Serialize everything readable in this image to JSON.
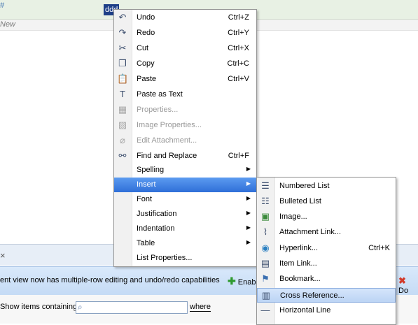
{
  "background": {
    "top_row_marker": "#",
    "selected_text": "ddd",
    "new_row_text": "New",
    "close_glyph": "×",
    "info_message": "ent view now has multiple-row editing and undo/redo capabilities",
    "enable_label": "Enab",
    "delete_label": "Do",
    "filter_label": "Show items containing",
    "filter_value": "",
    "where_label": "where"
  },
  "context_menu": {
    "items": [
      {
        "label": "Undo",
        "shortcut": "Ctrl+Z",
        "icon": "undo-icon",
        "disabled": false
      },
      {
        "label": "Redo",
        "shortcut": "Ctrl+Y",
        "icon": "redo-icon",
        "disabled": false
      },
      {
        "label": "Cut",
        "shortcut": "Ctrl+X",
        "icon": "cut-icon",
        "disabled": false
      },
      {
        "label": "Copy",
        "shortcut": "Ctrl+C",
        "icon": "copy-icon",
        "disabled": false
      },
      {
        "label": "Paste",
        "shortcut": "Ctrl+V",
        "icon": "paste-icon",
        "disabled": false
      },
      {
        "label": "Paste as Text",
        "shortcut": "",
        "icon": "paste-text-icon",
        "disabled": false
      },
      {
        "label": "Properties...",
        "shortcut": "",
        "icon": "properties-icon",
        "disabled": true
      },
      {
        "label": "Image Properties...",
        "shortcut": "",
        "icon": "image-properties-icon",
        "disabled": true
      },
      {
        "label": "Edit Attachment...",
        "shortcut": "",
        "icon": "attachment-icon",
        "disabled": true
      },
      {
        "label": "Find and Replace",
        "shortcut": "Ctrl+F",
        "icon": "binoculars-icon",
        "disabled": false
      },
      {
        "label": "Spelling",
        "submenu": true
      },
      {
        "label": "Insert",
        "submenu": true,
        "active": true
      },
      {
        "label": "Font",
        "submenu": true
      },
      {
        "label": "Justification",
        "submenu": true
      },
      {
        "label": "Indentation",
        "submenu": true
      },
      {
        "label": "Table",
        "submenu": true
      },
      {
        "label": "List Properties...",
        "submenu": false
      }
    ]
  },
  "insert_submenu": {
    "items": [
      {
        "label": "Numbered List",
        "shortcut": "",
        "icon": "numbered-list-icon"
      },
      {
        "label": "Bulleted List",
        "shortcut": "",
        "icon": "bulleted-list-icon"
      },
      {
        "label": "Image...",
        "shortcut": "",
        "icon": "image-icon"
      },
      {
        "label": "Attachment Link...",
        "shortcut": "",
        "icon": "paperclip-icon"
      },
      {
        "label": "Hyperlink...",
        "shortcut": "Ctrl+K",
        "icon": "globe-icon"
      },
      {
        "label": "Item Link...",
        "shortcut": "",
        "icon": "item-link-icon"
      },
      {
        "label": "Bookmark...",
        "shortcut": "",
        "icon": "bookmark-flag-icon"
      },
      {
        "label": "Cross Reference...",
        "shortcut": "",
        "icon": "cross-reference-icon",
        "hovered": true
      },
      {
        "label": "Horizontal Line",
        "shortcut": "",
        "icon": "horizontal-line-icon"
      }
    ]
  },
  "colors": {
    "highlight": "#2f6fd8",
    "hover": "#bcd4f4",
    "info_bar": "#c5dbf5"
  }
}
